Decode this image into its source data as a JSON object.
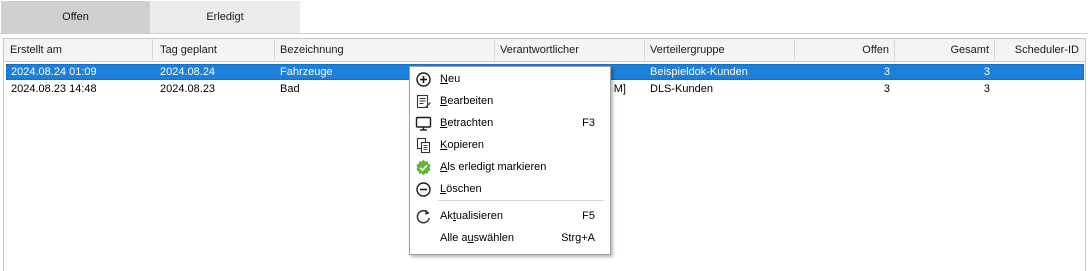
{
  "tabs": [
    {
      "label": "Offen"
    },
    {
      "label": "Erledigt"
    }
  ],
  "columns": [
    "Erstellt am",
    "Tag geplant",
    "Bezeichnung",
    "Verantwortlicher",
    "Verteilergruppe",
    "Offen",
    "Gesamt",
    "Scheduler-ID"
  ],
  "rows": [
    {
      "created": "2024.08.24 01:09",
      "planned": "2024.08.24",
      "name": "Fahrzeuge",
      "responsible": "",
      "group": "Beispieldok-Kunden",
      "open": "3",
      "total": "3",
      "scheduler": ""
    },
    {
      "created": "2024.08.23 14:48",
      "planned": "2024.08.23",
      "name": "Bad",
      "responsible": "M]",
      "group": "DLS-Kunden",
      "open": "3",
      "total": "3",
      "scheduler": ""
    }
  ],
  "context_menu": {
    "items": [
      {
        "pre": "",
        "mnemonic": "N",
        "post": "eu",
        "shortcut": "",
        "icon": "plus-circle-icon"
      },
      {
        "pre": "",
        "mnemonic": "B",
        "post": "earbeiten",
        "shortcut": "",
        "icon": "edit-list-icon"
      },
      {
        "pre": "",
        "mnemonic": "B",
        "post": "etrachten",
        "shortcut": "F3",
        "icon": "monitor-icon"
      },
      {
        "pre": "",
        "mnemonic": "K",
        "post": "opieren",
        "shortcut": "",
        "icon": "copy-icon"
      },
      {
        "pre": "",
        "mnemonic": "A",
        "post": "ls erledigt markieren",
        "shortcut": "",
        "icon": "green-check-badge-icon"
      },
      {
        "pre": "",
        "mnemonic": "L",
        "post": "öschen",
        "shortcut": "",
        "icon": "minus-circle-icon"
      },
      {
        "pre": "Ak",
        "mnemonic": "t",
        "post": "ualisieren",
        "shortcut": "F5",
        "icon": "refresh-icon"
      },
      {
        "pre": "Alle a",
        "mnemonic": "u",
        "post": "swählen",
        "shortcut": "Strg+A",
        "icon": ""
      }
    ]
  },
  "colors": {
    "selection": "#1c7fd9",
    "active_tab": "#d0d0d0",
    "inactive_tab": "#ececec",
    "check_badge": "#5cb82e"
  }
}
